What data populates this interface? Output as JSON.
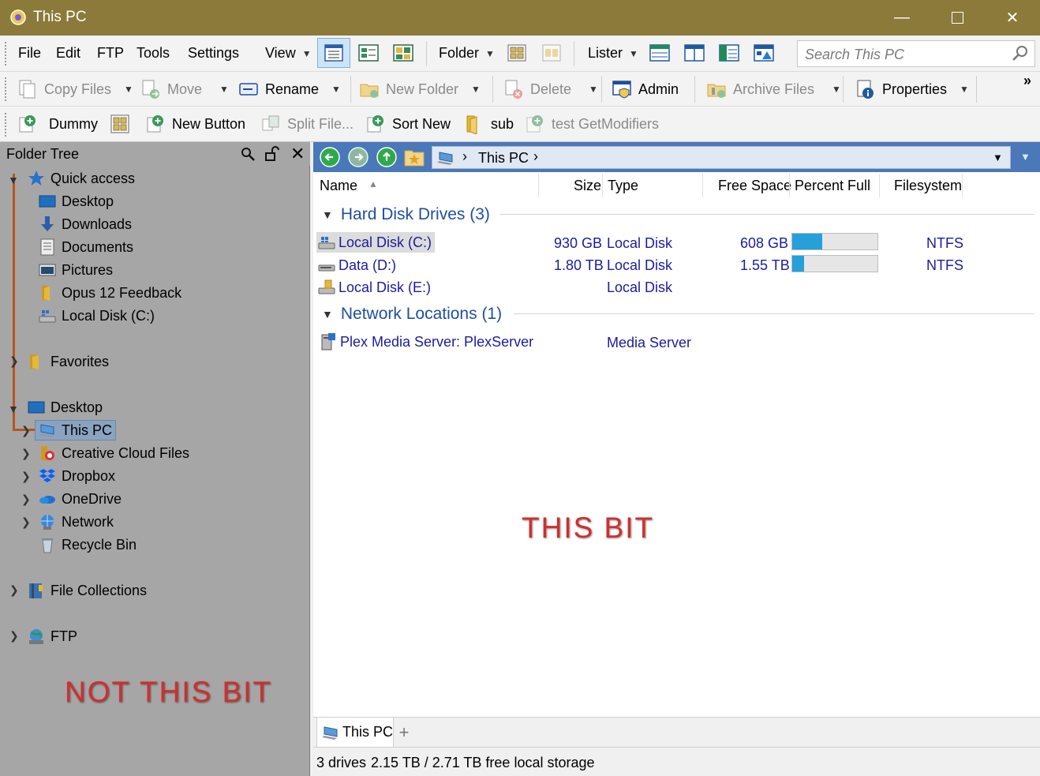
{
  "window": {
    "title": "This PC"
  },
  "menu": {
    "file": "File",
    "edit": "Edit",
    "ftp": "FTP",
    "tools": "Tools",
    "settings": "Settings",
    "view": "View",
    "folder": "Folder",
    "lister": "Lister"
  },
  "search": {
    "placeholder": "Search This PC"
  },
  "toolbar2": {
    "copy": "Copy Files",
    "move": "Move",
    "rename": "Rename",
    "new_folder": "New Folder",
    "delete": "Delete",
    "admin": "Admin",
    "archive": "Archive Files",
    "properties": "Properties"
  },
  "toolbar3": {
    "dummy": "Dummy",
    "new_button": "New Button",
    "split": "Split File...",
    "sort_new": "Sort New",
    "sub": "sub",
    "test": "test GetModifiers"
  },
  "folder_tree": {
    "title": "Folder Tree",
    "items": [
      {
        "label": "Quick access"
      },
      {
        "label": "Desktop"
      },
      {
        "label": "Downloads"
      },
      {
        "label": "Documents"
      },
      {
        "label": "Pictures"
      },
      {
        "label": "Opus 12 Feedback"
      },
      {
        "label": "Local Disk (C:)"
      },
      {
        "label": "Favorites"
      },
      {
        "label": "Desktop"
      },
      {
        "label": "This PC"
      },
      {
        "label": "Creative Cloud Files"
      },
      {
        "label": "Dropbox"
      },
      {
        "label": "OneDrive"
      },
      {
        "label": "Network"
      },
      {
        "label": "Recycle Bin"
      },
      {
        "label": "File Collections"
      },
      {
        "label": "FTP"
      }
    ],
    "annotation": "NOT THIS BIT"
  },
  "lister": {
    "path": "This PC",
    "columns": {
      "name": "Name",
      "size": "Size",
      "type": "Type",
      "free": "Free Space",
      "percent": "Percent Full",
      "fs": "Filesystem"
    },
    "groups": [
      {
        "title": "Hard Disk Drives (3)"
      },
      {
        "title": "Network Locations (1)"
      }
    ],
    "drives": [
      {
        "name": "Local Disk (C:)",
        "size": "930 GB",
        "type": "Local Disk",
        "free": "608 GB",
        "percent_full": 0.35,
        "fs": "NTFS"
      },
      {
        "name": "Data (D:)",
        "size": "1.80 TB",
        "type": "Local Disk",
        "free": "1.55 TB",
        "percent_full": 0.14,
        "fs": "NTFS"
      },
      {
        "name": "Local Disk (E:)",
        "size": "",
        "type": "Local Disk",
        "free": "",
        "percent_full": null,
        "fs": ""
      }
    ],
    "network": [
      {
        "name": "Plex Media Server: PlexServer",
        "type": "Media Server"
      }
    ],
    "annotation": "THIS BIT",
    "tab_label": "This PC",
    "status_count": "3 drives",
    "status_storage": "2.15 TB / 2.71 TB free local storage"
  },
  "colors": {
    "titlebar": "#8c7a3a",
    "addressbar": "#4a78b8",
    "tree_bg": "#a6a6a6",
    "link_text": "#1c1c9c",
    "group_text": "#1f4e9c",
    "bar_fill": "#26a0da",
    "annotation": "#d12e2e"
  }
}
